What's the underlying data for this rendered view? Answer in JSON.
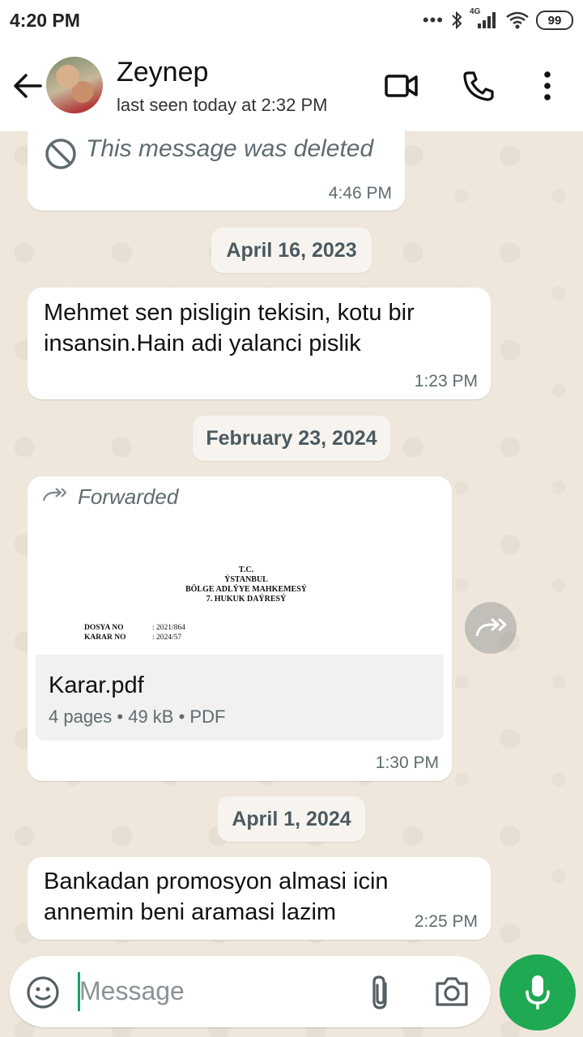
{
  "status_bar": {
    "time": "4:20 PM",
    "dots": "•••",
    "network": "4G",
    "battery": "99"
  },
  "header": {
    "name": "Zeynep",
    "status": "last seen today at 2:32 PM"
  },
  "messages": {
    "deleted": {
      "text": "This message was deleted",
      "time": "4:46 PM"
    },
    "date1": "April 16, 2023",
    "msg1": {
      "line1": "Mehmet sen pisligin tekisin, kotu bir",
      "line2": "insansin.Hain adi yalanci pislik",
      "time": "1:23 PM"
    },
    "date2": "February 23, 2024",
    "doc": {
      "forwarded": "Forwarded",
      "preview_head1": "T.C.",
      "preview_head2": "ÝSTANBUL",
      "preview_head3": "BÖLGE ADLÝYE MAHKEMESÝ",
      "preview_head4": "7. HUKUK DAÝRESÝ",
      "row1_label": "DOSYA NO",
      "row1_value": ": 2021/864",
      "row2_label": "KARAR NO",
      "row2_value": ": 2024/57",
      "filename": "Karar.pdf",
      "info": "4 pages • 49 kB • PDF",
      "time": "1:30 PM"
    },
    "date3": "April 1, 2024",
    "msg2": {
      "line1": "Bankadan promosyon almasi icin",
      "line2": "annemin beni aramasi lazim",
      "time": "2:25 PM"
    }
  },
  "input": {
    "placeholder": "Message"
  },
  "colors": {
    "accent_green": "#1ea952",
    "chat_bg": "#efe7dc",
    "caret": "#1a9c6b"
  }
}
